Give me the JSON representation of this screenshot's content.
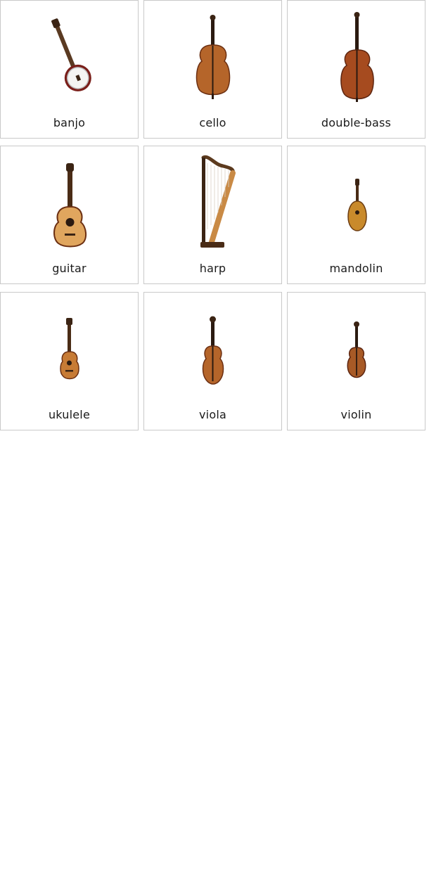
{
  "cards": [
    {
      "label": "banjo",
      "icon": "banjo-icon"
    },
    {
      "label": "cello",
      "icon": "cello-icon"
    },
    {
      "label": "double-bass",
      "icon": "double-bass-icon"
    },
    {
      "label": "guitar",
      "icon": "guitar-icon"
    },
    {
      "label": "harp",
      "icon": "harp-icon"
    },
    {
      "label": "mandolin",
      "icon": "mandolin-icon"
    },
    {
      "label": "ukulele",
      "icon": "ukulele-icon"
    },
    {
      "label": "viola",
      "icon": "viola-icon"
    },
    {
      "label": "violin",
      "icon": "violin-icon"
    }
  ],
  "colors": {
    "card_border": "#c9c9c9",
    "wood": "#b5652a",
    "wood_dark": "#6b2f12",
    "wood_light": "#e0a65e"
  }
}
